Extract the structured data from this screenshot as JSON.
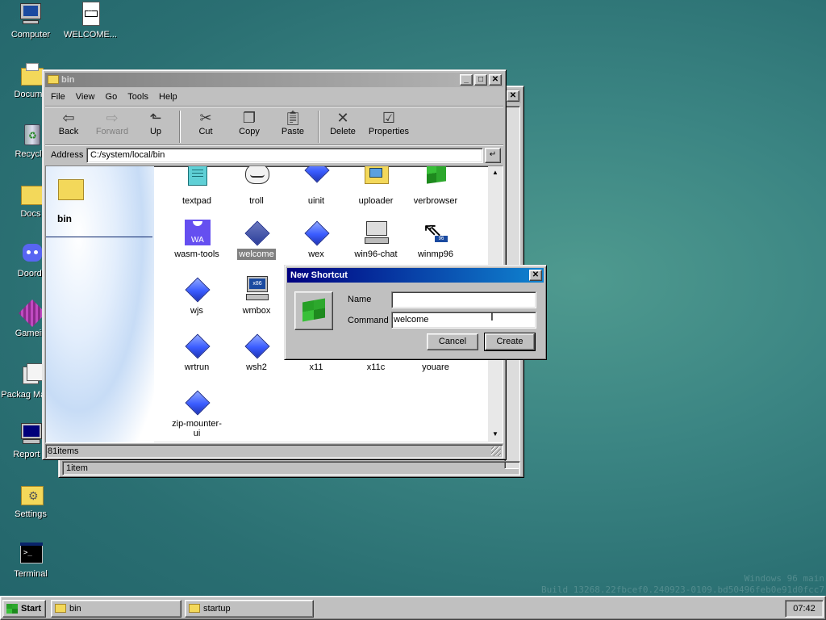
{
  "desktop": {
    "icons": [
      {
        "label": "Computer",
        "icon": "computer-icon"
      },
      {
        "label": "WELCOME...",
        "icon": "markdown-file-icon"
      },
      {
        "label": "Docume",
        "icon": "documents-folder-icon"
      },
      {
        "label": "Recycle",
        "icon": "recycle-bin-icon"
      },
      {
        "label": "Docs",
        "icon": "folder-icon"
      },
      {
        "label": "Doordi",
        "icon": "discord-icon"
      },
      {
        "label": "Gamein",
        "icon": "game-icon"
      },
      {
        "label": "Packag Manag",
        "icon": "package-manager-icon"
      },
      {
        "label": "Report B",
        "icon": "report-bug-icon"
      },
      {
        "label": "Settings",
        "icon": "settings-icon"
      },
      {
        "label": "Terminal",
        "icon": "terminal-icon"
      }
    ],
    "watermark_line1": "Windows 96 main",
    "watermark_line2": "Build 13268.22fbcef0.240923-0109.bd50496feb0e91d0fcc7"
  },
  "back_window": {
    "status": "1item"
  },
  "explorer": {
    "title": "bin",
    "menu": [
      "File",
      "View",
      "Go",
      "Tools",
      "Help"
    ],
    "toolbar": {
      "back": "Back",
      "forward": "Forward",
      "up": "Up",
      "cut": "Cut",
      "copy": "Copy",
      "paste": "Paste",
      "delete": "Delete",
      "properties": "Properties"
    },
    "address_label": "Address",
    "address_value": "C:/system/local/bin",
    "sidebar_title": "bin",
    "files": [
      {
        "label": "textpad",
        "icon": "textpad-icon"
      },
      {
        "label": "troll",
        "icon": "trollface-icon"
      },
      {
        "label": "uinit",
        "icon": "blue-diamond-icon"
      },
      {
        "label": "uploader",
        "icon": "uploader-icon"
      },
      {
        "label": "verbrowser",
        "icon": "windows-flag-icon"
      },
      {
        "label": "wasm-tools",
        "icon": "wasm-icon"
      },
      {
        "label": "welcome",
        "icon": "blue-diamond-icon",
        "selected": true
      },
      {
        "label": "wex",
        "icon": "blue-diamond-icon"
      },
      {
        "label": "win96-chat",
        "icon": "chat-computer-icon"
      },
      {
        "label": "winmp96",
        "icon": "media-player-icon"
      },
      {
        "label": "wjs",
        "icon": "blue-diamond-icon"
      },
      {
        "label": "wmbox",
        "icon": "x86-computer-icon"
      },
      {
        "label": "wrtrun",
        "icon": "blue-diamond-icon"
      },
      {
        "label": "wsh2",
        "icon": "blue-diamond-icon"
      },
      {
        "label": "x11",
        "icon": "blue-diamond-icon"
      },
      {
        "label": "x11c",
        "icon": "blue-diamond-icon"
      },
      {
        "label": "youare",
        "icon": "blue-diamond-icon"
      },
      {
        "label": "zip-mounter-ui",
        "icon": "blue-diamond-icon"
      }
    ],
    "status": "81items"
  },
  "dialog": {
    "title": "New Shortcut",
    "name_label": "Name",
    "name_value": "",
    "command_label": "Command",
    "command_value": "welcome",
    "cancel": "Cancel",
    "create": "Create"
  },
  "taskbar": {
    "start": "Start",
    "tasks": [
      {
        "label": "bin"
      },
      {
        "label": "startup"
      }
    ],
    "clock": "07:42"
  },
  "colors": {
    "desktop": "#2f7a7c",
    "title_active": "#000080",
    "title_inactive": "#808080",
    "face": "#c0c0c0",
    "selection": "#808080"
  }
}
